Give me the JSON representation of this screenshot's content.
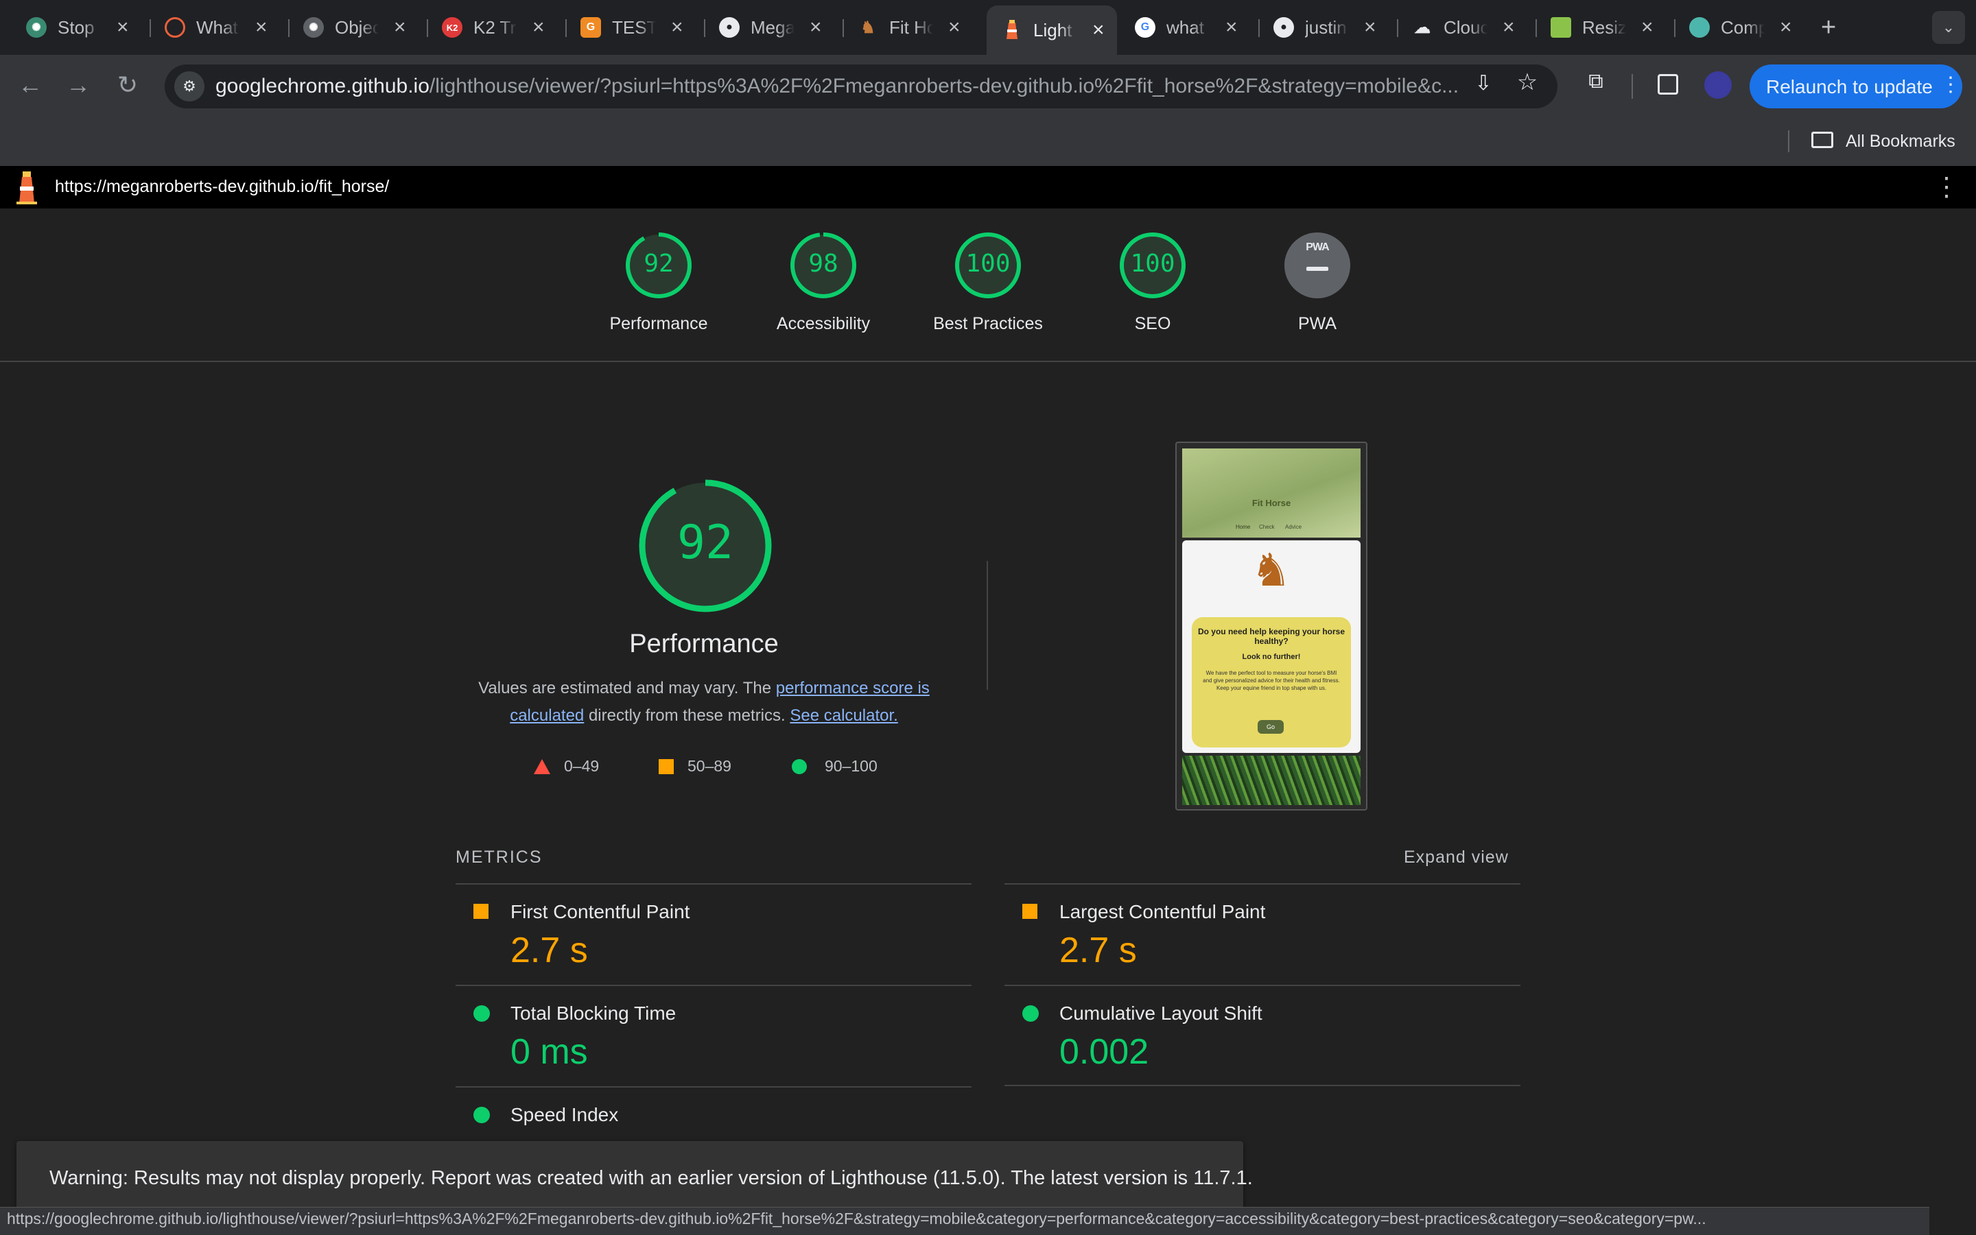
{
  "browser": {
    "tabs": [
      {
        "title": "Stop",
        "icon": "openai-icon",
        "color": "#3a8a72"
      },
      {
        "title": "What",
        "icon": "target-icon",
        "color": "#e8603c"
      },
      {
        "title": "Objec",
        "icon": "openai-icon",
        "color": "#8a8f98"
      },
      {
        "title": "K2 Tr",
        "icon": "k2-icon",
        "color": "#e03a3a"
      },
      {
        "title": "TEST",
        "icon": "chevron-logo-icon",
        "color": "#f08a24"
      },
      {
        "title": "Mega",
        "icon": "github-icon",
        "color": "#e8eaed"
      },
      {
        "title": "Fit Ho",
        "icon": "horse-icon",
        "color": "#c47a3a"
      },
      {
        "title": "Light",
        "icon": "lighthouse-icon",
        "color": "#f06a3a"
      },
      {
        "title": "what",
        "icon": "google-icon",
        "color": "#4285f4"
      },
      {
        "title": "justin",
        "icon": "github-icon",
        "color": "#e8eaed"
      },
      {
        "title": "Clouc",
        "icon": "cloud-icon",
        "color": "#e8eaed"
      },
      {
        "title": "Resiz",
        "icon": "resize-icon",
        "color": "#8bc34a"
      },
      {
        "title": "Comp",
        "icon": "compress-icon",
        "color": "#4db6ac"
      }
    ],
    "url_host": "googlechrome.github.io",
    "url_rest": "/lighthouse/viewer/?psiurl=https%3A%2F%2Fmeganroberts-dev.github.io%2Ffit_horse%2F&strategy=mobile&c...",
    "relaunch_label": "Relaunch to update",
    "bookmarks_label": "All Bookmarks"
  },
  "lighthouse": {
    "report_url": "https://meganroberts-dev.github.io/fit_horse/",
    "gauges": [
      {
        "score": "92",
        "label": "Performance",
        "fraction": 0.92
      },
      {
        "score": "98",
        "label": "Accessibility",
        "fraction": 0.98
      },
      {
        "score": "100",
        "label": "Best Practices",
        "fraction": 1.0
      },
      {
        "score": "100",
        "label": "SEO",
        "fraction": 1.0
      },
      {
        "score": "PWA",
        "label": "PWA",
        "fraction": 0
      }
    ],
    "performance": {
      "score": "92",
      "fraction": 0.92,
      "title": "Performance",
      "desc_prefix": "Values are estimated and may vary. The ",
      "desc_link1": "performance score is calculated",
      "desc_middle": " directly from these metrics. ",
      "desc_link2": "See calculator."
    },
    "legend": [
      {
        "range": "0–49",
        "color": "#ff4e42"
      },
      {
        "range": "50–89",
        "color": "#ffa400"
      },
      {
        "range": "90–100",
        "color": "#0cce6b"
      }
    ],
    "screenshot": {
      "brand": "Fit Horse",
      "nav": [
        "Home",
        "Check",
        "Advice"
      ],
      "heading": "Do you need help keeping your horse healthy?",
      "subheading": "Look no further!",
      "body": "We have the perfect tool to measure your horse's BMI and give personalized advice for their health and fitness. Keep your equine friend in top shape with us.",
      "button": "Go"
    },
    "metrics_header": "METRICS",
    "expand_label": "Expand view",
    "metrics": [
      {
        "name": "First Contentful Paint",
        "value": "2.7 s",
        "rating": "average"
      },
      {
        "name": "Largest Contentful Paint",
        "value": "2.7 s",
        "rating": "average"
      },
      {
        "name": "Total Blocking Time",
        "value": "0 ms",
        "rating": "pass"
      },
      {
        "name": "Cumulative Layout Shift",
        "value": "0.002",
        "rating": "pass"
      },
      {
        "name": "Speed Index",
        "value": "",
        "rating": "pass"
      }
    ],
    "warning": "Warning: Results may not display properly. Report was created with an earlier version of Lighthouse (11.5.0). The latest version is 11.7.1."
  },
  "status_url": "https://googlechrome.github.io/lighthouse/viewer/?psiurl=https%3A%2F%2Fmeganroberts-dev.github.io%2Ffit_horse%2F&strategy=mobile&category=performance&category=accessibility&category=best-practices&category=seo&category=pw...",
  "colors": {
    "pass": "#0cce6b",
    "average": "#ffa400",
    "fail": "#ff4e42",
    "link": "#8ab4f8",
    "accent": "#1a73e8"
  }
}
